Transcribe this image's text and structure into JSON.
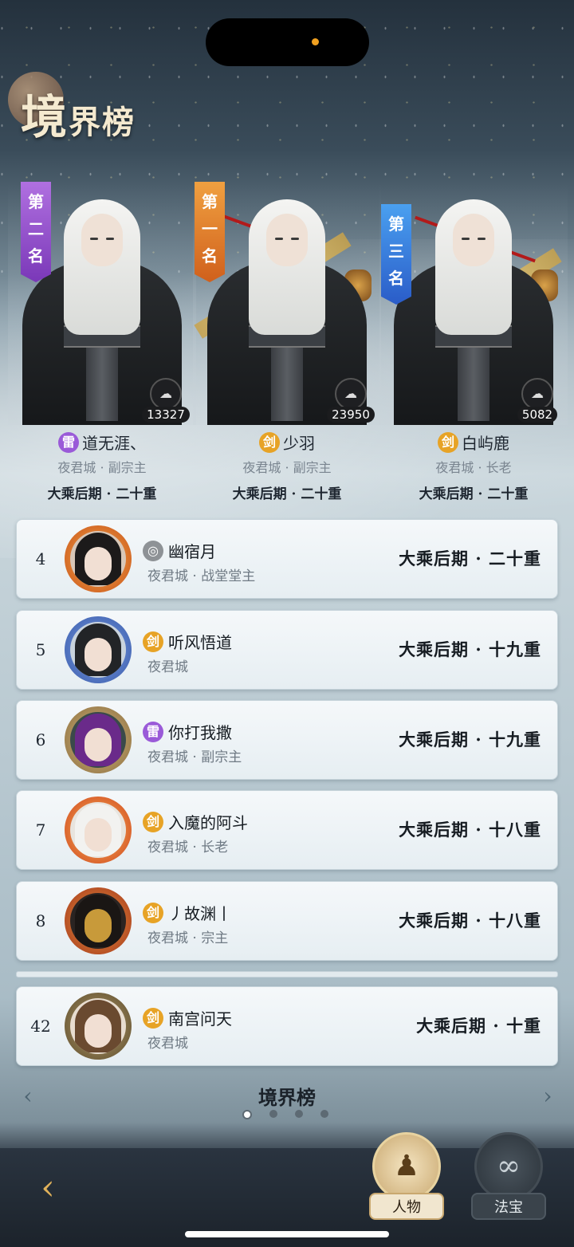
{
  "title": {
    "first": "境",
    "rest": "界榜"
  },
  "top3": [
    {
      "banner": [
        "第",
        "二",
        "名"
      ],
      "power": "13327",
      "tag": "雷",
      "name": "道无涯、",
      "sub": "夜君城 · 副宗主",
      "realm": "大乘后期 · 二十重"
    },
    {
      "banner": [
        "第",
        "一",
        "名"
      ],
      "power": "23950",
      "tag": "剑",
      "name": "少羽",
      "sub": "夜君城 · 副宗主",
      "realm": "大乘后期 · 二十重"
    },
    {
      "banner": [
        "第",
        "三",
        "名"
      ],
      "power": "5082",
      "tag": "剑",
      "name": "白屿鹿",
      "sub": "夜君城 · 长老",
      "realm": "大乘后期 · 二十重"
    }
  ],
  "rows": [
    {
      "rank": "4",
      "tag": "",
      "name": "幽宿月",
      "sub": "夜君城 · 战堂堂主",
      "realm": "大乘后期 · 二十重"
    },
    {
      "rank": "5",
      "tag": "剑",
      "name": "听风悟道",
      "sub": "夜君城",
      "realm": "大乘后期 · 十九重"
    },
    {
      "rank": "6",
      "tag": "雷",
      "name": "你打我撒",
      "sub": "夜君城 · 副宗主",
      "realm": "大乘后期 · 十九重"
    },
    {
      "rank": "7",
      "tag": "剑",
      "name": "入魔的阿斗",
      "sub": "夜君城 · 长老",
      "realm": "大乘后期 · 十八重"
    },
    {
      "rank": "8",
      "tag": "剑",
      "name": "丿故渊丨",
      "sub": "夜君城 · 宗主",
      "realm": "大乘后期 · 十八重"
    }
  ],
  "self_row": {
    "rank": "42",
    "tag": "剑",
    "name": "南宫问天",
    "sub": "夜君城",
    "realm": "大乘后期 · 十重"
  },
  "nav": {
    "title": "境界榜",
    "left_arrow": "‹",
    "right_arrow": "›"
  },
  "bottom": {
    "back_icon": "‹",
    "tab1": "人物",
    "tab2": "法宝"
  },
  "colors": {
    "lei": "#9a5ad8",
    "jian": "#e7a326",
    "rank1": "#d0601c",
    "rank2": "#7a38b8",
    "rank3": "#2a5cc8"
  }
}
